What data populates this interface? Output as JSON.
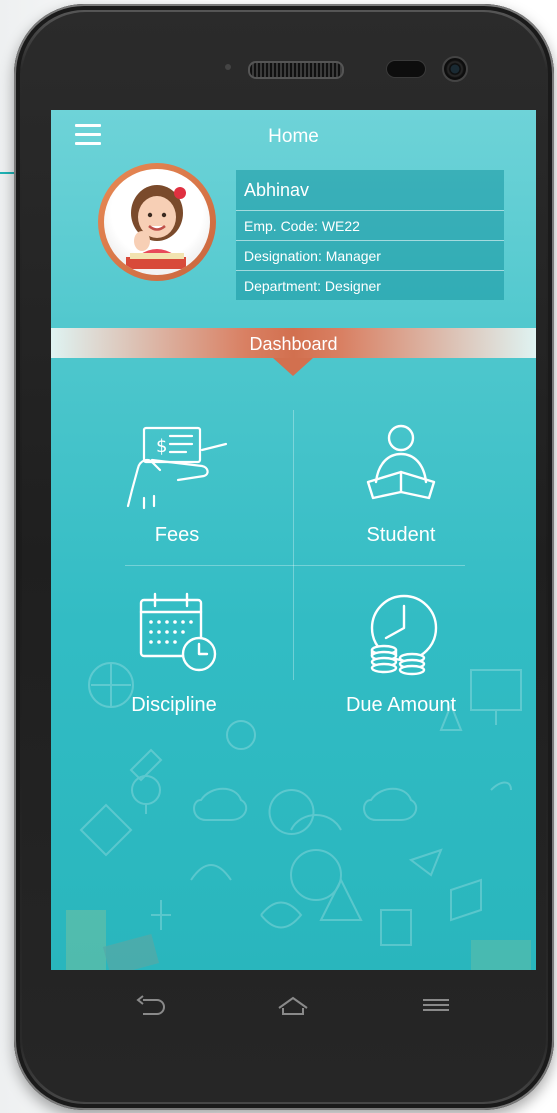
{
  "header": {
    "title": "Home",
    "menu_icon": "hamburger-menu-icon"
  },
  "profile": {
    "name": "Abhinav",
    "emp_code": "Emp. Code: WE22",
    "designation": "Designation: Manager",
    "department": "Department: Designer"
  },
  "dashboard": {
    "label": "Dashboard",
    "tiles": [
      {
        "label": "Fees",
        "icon": "cash-hand-icon"
      },
      {
        "label": "Student",
        "icon": "student-reading-icon"
      },
      {
        "label": "Discipline",
        "icon": "calendar-clock-icon"
      },
      {
        "label": "Due Amount",
        "icon": "clock-coins-icon"
      }
    ]
  },
  "nav": {
    "back_icon": "back-arrow-icon",
    "home_icon": "home-icon",
    "menu_icon": "menu-lines-icon"
  },
  "colors": {
    "screen_top": "#6ed3d8",
    "screen_bottom": "#29b6bd",
    "accent_orange": "#d2704f",
    "accent_line": "#1fb3b5"
  }
}
